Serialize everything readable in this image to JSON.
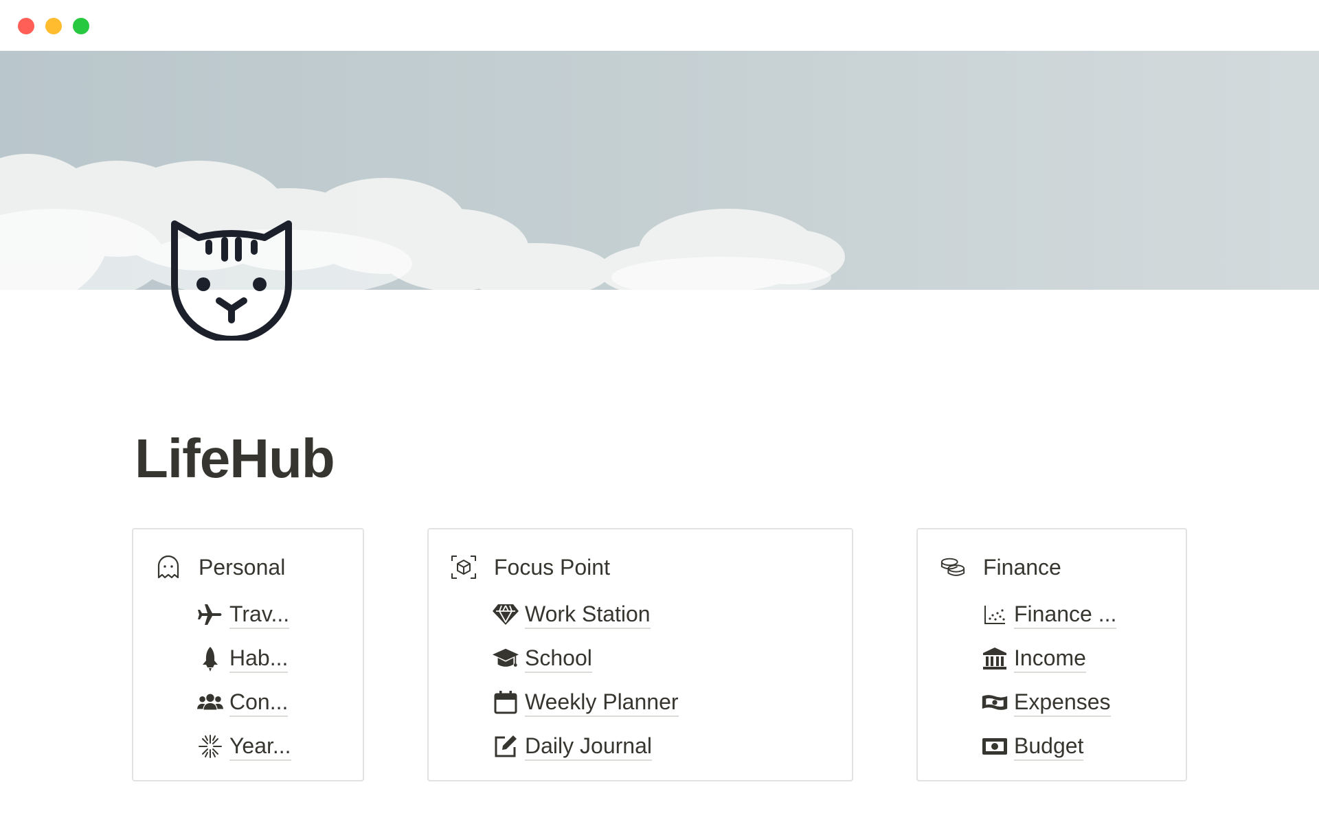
{
  "window": {
    "controls": [
      {
        "name": "close",
        "color": "#ff5f57"
      },
      {
        "name": "minimize",
        "color": "#febc2e"
      },
      {
        "name": "maximize",
        "color": "#28c840"
      }
    ]
  },
  "cover": {
    "image": "sky-with-clouds"
  },
  "page": {
    "icon": "cat-face-icon",
    "title": "LifeHub"
  },
  "cards": {
    "personal": {
      "title": "Personal",
      "icon": "ghost-icon",
      "items": [
        {
          "label": "Trav...",
          "icon": "airplane-icon"
        },
        {
          "label": "Hab...",
          "icon": "rocket-icon"
        },
        {
          "label": "Con...",
          "icon": "people-icon"
        },
        {
          "label": "Year...",
          "icon": "sparkle-burst-icon"
        }
      ]
    },
    "focus": {
      "title": "Focus Point",
      "icon": "cube-scan-icon",
      "items": [
        {
          "label": "Work Station",
          "icon": "gem-icon"
        },
        {
          "label": "School",
          "icon": "graduation-cap-icon"
        },
        {
          "label": "Weekly Planner",
          "icon": "calendar-icon"
        },
        {
          "label": "Daily Journal",
          "icon": "edit-square-icon"
        }
      ]
    },
    "finance": {
      "title": "Finance",
      "icon": "coins-icon",
      "items": [
        {
          "label": "Finance ...",
          "icon": "scatter-chart-icon"
        },
        {
          "label": "Income",
          "icon": "bank-icon"
        },
        {
          "label": "Expenses",
          "icon": "money-bill-wave-icon"
        },
        {
          "label": "Budget",
          "icon": "money-bill-icon"
        }
      ]
    }
  },
  "colors": {
    "text": "#37352f",
    "border": "#e3e2e0",
    "icon": "#37352f"
  }
}
